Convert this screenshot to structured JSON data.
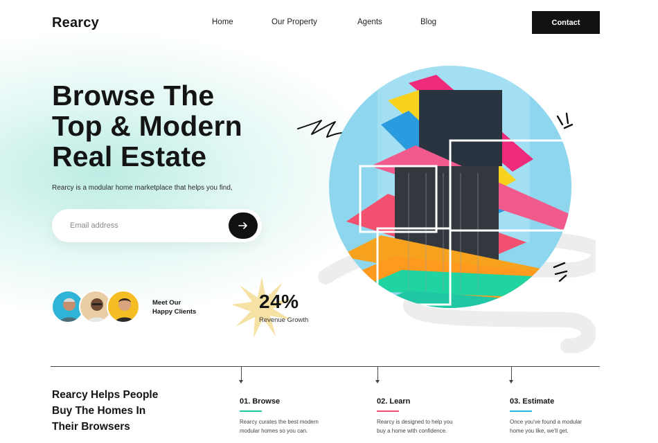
{
  "header": {
    "logo": "Rearcy",
    "nav": [
      {
        "label": "Home"
      },
      {
        "label": "Our Property"
      },
      {
        "label": "Agents"
      },
      {
        "label": "Blog"
      }
    ],
    "contact_label": "Contact"
  },
  "hero": {
    "title_lines": [
      "Browse The",
      "Top & Modern",
      "Real Estate"
    ],
    "subtitle": "Rearcy is a modular home marketplace that helps you find,",
    "email_placeholder": "Email address",
    "submit_icon": "arrow-right-icon"
  },
  "clients": {
    "label_lines": [
      "Meet Our",
      "Happy Clients"
    ],
    "avatar_count": 3
  },
  "revenue": {
    "value": "24%",
    "label": "Revenue Growth"
  },
  "features": {
    "title_lines": [
      "Rearcy Helps People",
      "Buy The Homes In",
      "Their Browsers"
    ],
    "steps": [
      {
        "title": "01. Browse",
        "text_lines": [
          "Rearcy curates the best modern",
          "modular homes so you can."
        ],
        "accent": "#1fc7a5"
      },
      {
        "title": "02. Learn",
        "text_lines": [
          "Rearcy is designed to help you",
          "buy a home with confidence."
        ],
        "accent": "#f2506f"
      },
      {
        "title": "03. Estimate",
        "text_lines": [
          "Once you've found a modular",
          "home you like, we'll get."
        ],
        "accent": "#22b8e6"
      }
    ]
  },
  "colors": {
    "dark": "#111111",
    "mint_glow": "#b0e9de",
    "sky": "#8ed6ee",
    "burst": "#f6e2a5"
  }
}
